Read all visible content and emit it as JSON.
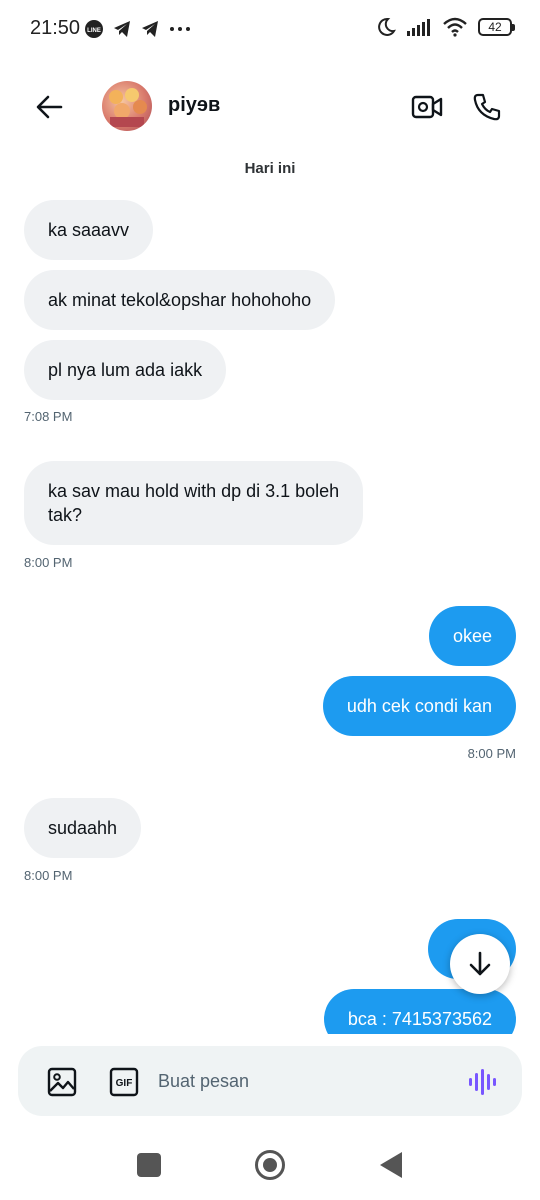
{
  "status_bar": {
    "time": "21:50",
    "left_icons": [
      "line-icon",
      "telegram-icon",
      "telegram-icon",
      "more-dots-icon"
    ],
    "right_icons": [
      "moon-icon",
      "signal-icon",
      "wifi-icon"
    ],
    "battery": "42"
  },
  "header": {
    "back_icon": "arrow-left-icon",
    "contact_name": "piyɘʙ",
    "video_icon": "video-camera-icon",
    "call_icon": "phone-icon"
  },
  "conversation": {
    "day_label": "Hari ini",
    "messages": [
      {
        "direction": "in",
        "text": "ka saaavv"
      },
      {
        "direction": "in",
        "text": "ak minat tekol&opshar hohohoho"
      },
      {
        "direction": "in",
        "text": "pl nya lum ada iakk",
        "time": "7:08 PM"
      },
      {
        "direction": "in",
        "text_lines": [
          "ka sav mau hold with dp di 3.1 boleh",
          "tak?"
        ],
        "time": "8:00 PM"
      },
      {
        "direction": "out",
        "text": "okee"
      },
      {
        "direction": "out",
        "text": "udh cek condi kan",
        "time": "8:00 PM"
      },
      {
        "direction": "in",
        "text": "sudaahh",
        "time": "8:00 PM"
      },
      {
        "direction": "out",
        "text": ""
      },
      {
        "direction": "out",
        "text": "bca : 7415373562"
      }
    ]
  },
  "scroll_button_icon": "arrow-down-icon",
  "composer": {
    "image_icon": "image-icon",
    "gif_icon": "gif-icon",
    "gif_label": "GIF",
    "placeholder": "Buat pesan",
    "voice_icon": "voice-wave-icon"
  },
  "nav_bar": {
    "icons": [
      "recents-square-icon",
      "home-circle-icon",
      "back-triangle-icon"
    ]
  },
  "colors": {
    "outgoing_bubble": "#1d9bf0",
    "incoming_bubble": "#eff1f3",
    "voice_icon": "#7856ff"
  }
}
